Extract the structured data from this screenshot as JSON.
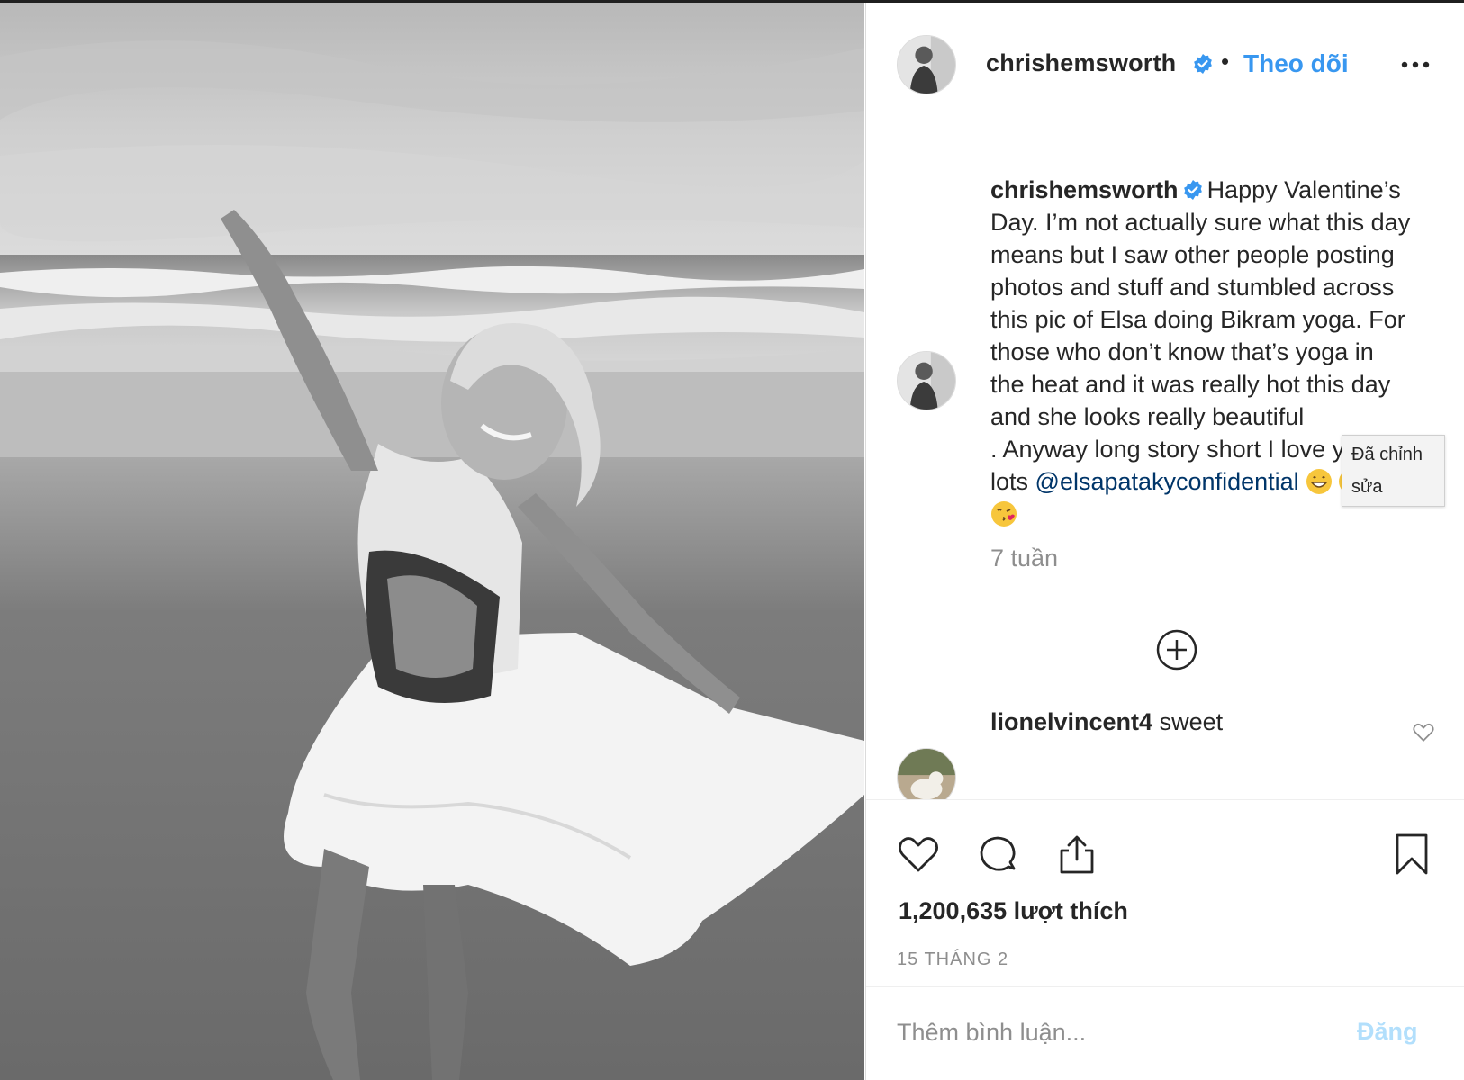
{
  "post": {
    "username": "chrishemsworth",
    "follow_label": "Theo dõi",
    "dot": "•",
    "caption": {
      "username": "chrishemsworth",
      "lines": [
        "Happy Valentine’s",
        "Day. I’m not actually sure what this day",
        "means but I saw other people posting",
        "photos and stuff and stumbled across",
        "this pic of Elsa doing Bikram yoga. For",
        "those who don’t know that’s yoga in",
        "the heat and it was really hot this day",
        "and she looks really beautiful",
        ". Anyway long story short I love you",
        "lots"
      ],
      "mention": "@elsapatakyconfidential",
      "emojis": [
        "grin-emoji",
        "grin-emoji",
        "kiss-emoji",
        "kiss-emoji"
      ]
    },
    "edited_tooltip": "Đã chỉnh sửa",
    "time_ago": "7 tuần",
    "comments": [
      {
        "username": "lionelvincent4",
        "text": "sweet"
      }
    ],
    "likes": "1,200,635 lượt thích",
    "date": "15 THÁNG 2",
    "comment_placeholder": "Thêm bình luận...",
    "post_label": "Đăng"
  },
  "colors": {
    "link_blue": "#3897f0",
    "mention_blue": "#003569",
    "muted_gray": "#8e8e8e",
    "post_disabled": "#b2dffc"
  }
}
